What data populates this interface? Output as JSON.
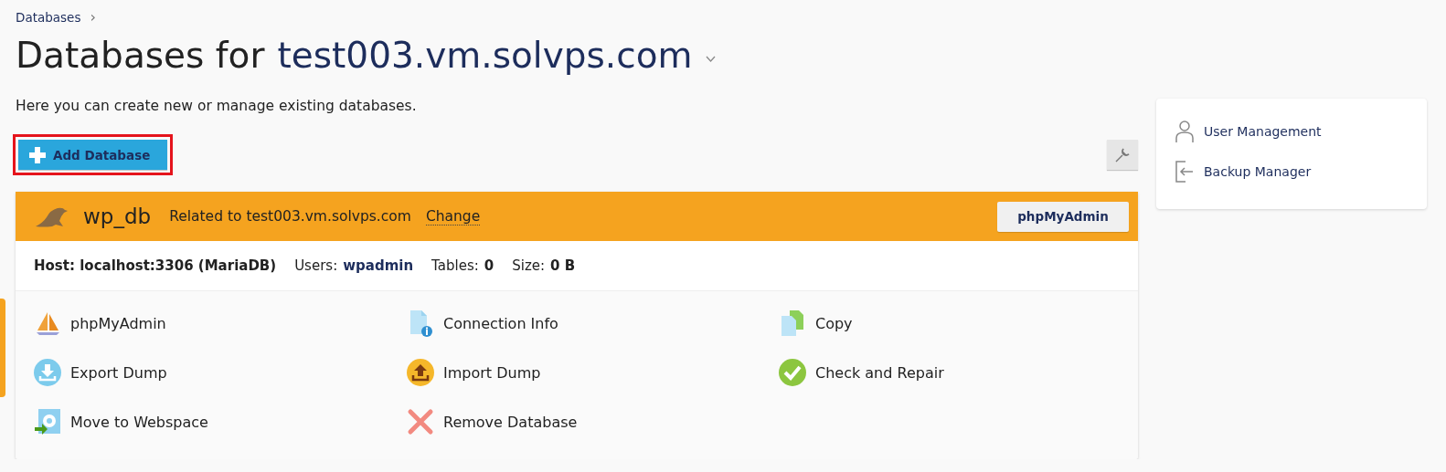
{
  "breadcrumb": {
    "label": "Databases",
    "separator": "›"
  },
  "heading": {
    "prefix": "Databases for",
    "domain": "test003.vm.solvps.com"
  },
  "description": "Here you can create new or manage existing databases.",
  "add_button": {
    "label": "Add Database",
    "highlighted": true
  },
  "database": {
    "name": "wp_db",
    "related": "Related to test003.vm.solvps.com",
    "change_link": "Change",
    "header_button": "phpMyAdmin",
    "host": "Host: localhost:3306 (MariaDB)",
    "users_label": "Users:",
    "users": "wpadmin",
    "tables_label": "Tables:",
    "tables": "0",
    "size_label": "Size:",
    "size": "0 B",
    "actions": [
      {
        "kind": "phpmyadmin",
        "label": "phpMyAdmin"
      },
      {
        "kind": "info",
        "label": "Connection Info"
      },
      {
        "kind": "copy",
        "label": "Copy"
      },
      {
        "kind": "export",
        "label": "Export Dump"
      },
      {
        "kind": "import",
        "label": "Import Dump"
      },
      {
        "kind": "check",
        "label": "Check and Repair"
      },
      {
        "kind": "move",
        "label": "Move to Webspace"
      },
      {
        "kind": "remove",
        "label": "Remove Database"
      }
    ]
  },
  "sidebar": {
    "items": [
      {
        "kind": "user",
        "label": "User Management"
      },
      {
        "kind": "backup",
        "label": "Backup Manager"
      }
    ]
  }
}
